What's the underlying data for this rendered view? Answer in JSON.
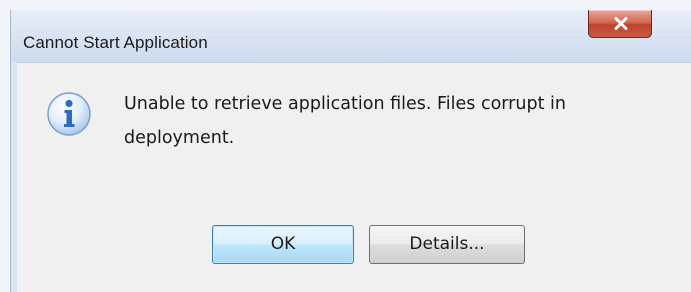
{
  "window": {
    "title": "Cannot Start Application",
    "close_icon": "close-x-icon"
  },
  "dialog": {
    "icon": "info-icon",
    "message": "Unable to retrieve application files. Files corrupt in deployment.",
    "buttons": {
      "ok_label": "OK",
      "details_label": "Details..."
    }
  },
  "colors": {
    "close_button": "#c8442d",
    "info_icon": "#2f6bbd",
    "default_button_border": "#3c7fb1"
  }
}
